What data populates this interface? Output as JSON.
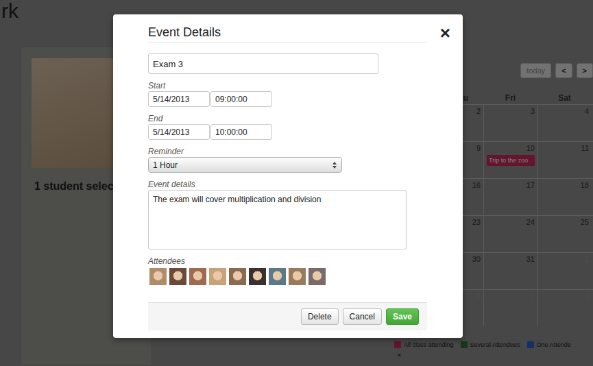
{
  "page": {
    "title": "rk"
  },
  "student_panel": {
    "selection": "1 student selec"
  },
  "calendar": {
    "today": {
      "label": "today",
      "disabled": true
    },
    "prev": "<",
    "next": ">",
    "day_headers": [
      "u",
      "Fri",
      "Sat"
    ],
    "weeks": [
      {
        "days": [
          {
            "date": "2",
            "other_month": false,
            "events": []
          },
          {
            "date": "3",
            "other_month": false,
            "events": []
          },
          {
            "date": "4",
            "other_month": false,
            "events": []
          }
        ]
      },
      {
        "days": [
          {
            "date": "9",
            "other_month": false,
            "events": []
          },
          {
            "date": "10",
            "other_month": false,
            "events": [
              {
                "title": "Trip to the zoo",
                "color": "#c8285a"
              }
            ]
          },
          {
            "date": "11",
            "other_month": false,
            "events": []
          }
        ]
      },
      {
        "days": [
          {
            "date": "16",
            "other_month": false,
            "events": []
          },
          {
            "date": "17",
            "other_month": false,
            "events": []
          },
          {
            "date": "18",
            "other_month": false,
            "events": []
          }
        ]
      },
      {
        "days": [
          {
            "date": "23",
            "other_month": false,
            "events": []
          },
          {
            "date": "24",
            "other_month": false,
            "events": []
          },
          {
            "date": "25",
            "other_month": false,
            "events": []
          }
        ]
      },
      {
        "days": [
          {
            "date": "30",
            "other_month": false,
            "events": []
          },
          {
            "date": "31",
            "other_month": false,
            "events": []
          },
          {
            "date": "1",
            "other_month": true,
            "events": []
          }
        ]
      },
      {
        "days": [
          {
            "date": "6",
            "other_month": true,
            "events": []
          },
          {
            "date": "7",
            "other_month": true,
            "events": []
          },
          {
            "date": "8",
            "other_month": true,
            "events": []
          }
        ]
      }
    ]
  },
  "legend": {
    "items": [
      {
        "label": "All class attending",
        "color": "#c8285a"
      },
      {
        "label": "Several Attendees",
        "color": "#2f6e40"
      },
      {
        "label": "One Attende",
        "color": "#2a5fd6"
      }
    ],
    "close": "×"
  },
  "dialog": {
    "title": "Event Details",
    "close": "×",
    "name": "Exam 3",
    "start": {
      "label": "Start",
      "date": "5/14/2013",
      "time": "09:00:00"
    },
    "end": {
      "label": "End",
      "date": "5/14/2013",
      "time": "10:00:00"
    },
    "reminder": {
      "label": "Reminder",
      "value": "1 Hour"
    },
    "details": {
      "label": "Event details",
      "value": "The exam will cover multiplication and division"
    },
    "attendees": {
      "label": "Attendees",
      "people": [
        {
          "color": "#b08c6a"
        },
        {
          "color": "#6b4a3a"
        },
        {
          "color": "#a06a50"
        },
        {
          "color": "#c9a27a"
        },
        {
          "color": "#8a6a50"
        },
        {
          "color": "#3a3030"
        },
        {
          "color": "#5a7a8a"
        },
        {
          "color": "#9a7a5a"
        },
        {
          "color": "#7a6a6a"
        }
      ]
    },
    "buttons": [
      {
        "label": "Delete",
        "kind": "default"
      },
      {
        "label": "Cancel",
        "kind": "default"
      },
      {
        "label": "Save",
        "kind": "primary"
      }
    ]
  }
}
